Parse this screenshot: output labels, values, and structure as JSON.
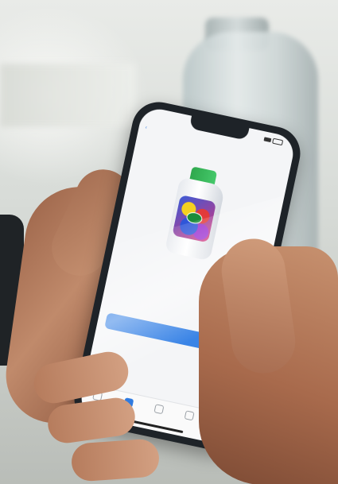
{
  "photo": {
    "subject": "hand-holding-phone",
    "background_object": "laundry-detergent-bottle"
  },
  "app": {
    "statusbar": {
      "time": ""
    },
    "navbar": {
      "back_label": "",
      "title": ""
    },
    "page_title": "",
    "product": {
      "name": "",
      "section_label": ""
    },
    "recommendation": {
      "label": "",
      "value": "",
      "description": ""
    },
    "edit_link": "",
    "primary_button": "",
    "secondary_link": "",
    "tabs": [
      {
        "label": "",
        "icon": "home-icon",
        "active": false
      },
      {
        "label": "",
        "icon": "scan-icon",
        "active": true
      },
      {
        "label": "",
        "icon": "box-icon",
        "active": false
      },
      {
        "label": "",
        "icon": "settings-icon",
        "active": false
      },
      {
        "label": "",
        "icon": "profile-icon",
        "active": false
      }
    ],
    "colors": {
      "accent": "#3a84e6",
      "cap": "#2ea84d"
    }
  }
}
